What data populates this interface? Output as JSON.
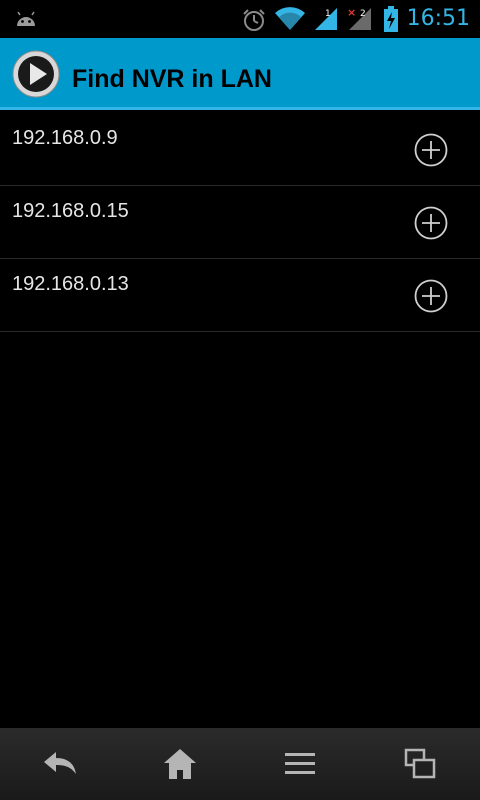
{
  "status_bar": {
    "time": "16:51",
    "icons": [
      "android-icon",
      "alarm-icon",
      "wifi-icon",
      "signal-1-icon",
      "signal-2-no-service-icon",
      "battery-charging-icon"
    ],
    "accent_color": "#33b5e5"
  },
  "action_bar": {
    "title": "Find NVR in LAN",
    "icon": "play-icon",
    "background_color": "#0099cc"
  },
  "devices": [
    {
      "ip": "192.168.0.9"
    },
    {
      "ip": "192.168.0.15"
    },
    {
      "ip": "192.168.0.13"
    }
  ],
  "nav_bar": {
    "buttons": [
      "back-icon",
      "home-icon",
      "menu-icon",
      "recent-apps-icon"
    ]
  }
}
